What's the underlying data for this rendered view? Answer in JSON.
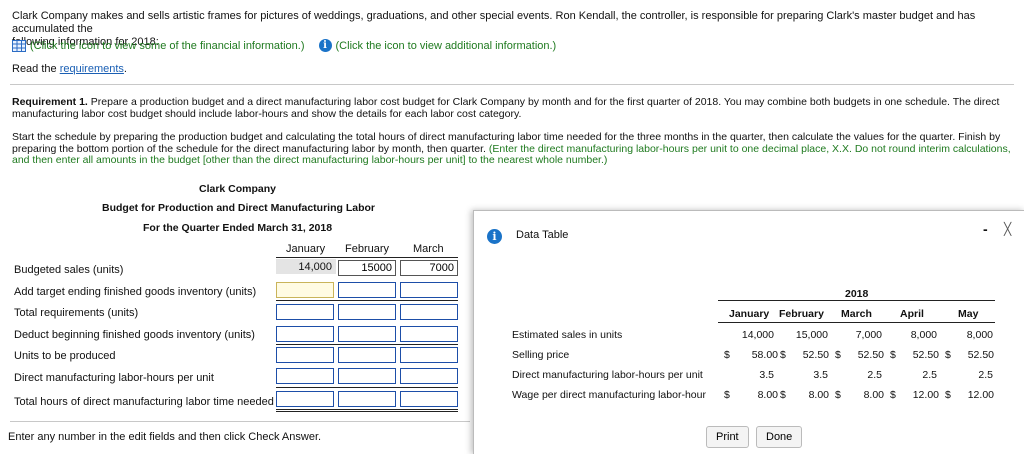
{
  "intro": {
    "line1": "Clark Company makes and sells artistic frames for pictures of weddings, graduations, and other special events. Ron Kendall, the controller, is responsible for preparing Clark's master budget and has accumulated the",
    "line2": "following information for 2018:",
    "fin_info": "(Click the icon to view some of the financial information.)",
    "add_info": "(Click the icon to view additional information.)",
    "read_the": "Read the ",
    "requirements_link": "requirements",
    "period": "."
  },
  "requirement": {
    "label": "Requirement 1.",
    "text_a": " Prepare a production budget and a direct manufacturing labor cost budget for Clark Company by month and for the first quarter of 2018. You may combine both budgets in one schedule. The direct",
    "text_b": "manufacturing labor cost budget should include labor-hours and show the details for each labor cost category.",
    "start_1": "Start the schedule by preparing the production budget and calculating the total hours of direct manufacturing labor time needed for the three months in the quarter, then calculate the values for the quarter. Finish by",
    "start_2a": "preparing the bottom portion of the schedule for the direct manufacturing labor by month, then quarter. ",
    "start_2b": "(Enter the direct manufacturing labor-hours per unit to one decimal place, X.X. Do not round interim calculations,",
    "start_3": "and then enter all amounts in the budget [other than the direct manufacturing labor-hours per unit] to the nearest whole number.)"
  },
  "budget": {
    "company": "Clark Company",
    "title": "Budget for Production and Direct Manufacturing Labor",
    "period": "For the Quarter Ended March 31, 2018",
    "columns": [
      "January",
      "February",
      "March"
    ],
    "rows": [
      {
        "label": "Budgeted sales (units)",
        "values": [
          "14,000",
          "15000",
          "7000"
        ]
      },
      {
        "label": "Add target ending finished goods inventory (units)",
        "values": [
          "",
          "",
          ""
        ]
      },
      {
        "label": "Total requirements (units)",
        "values": [
          "",
          "",
          ""
        ]
      },
      {
        "label": "Deduct beginning finished goods inventory (units)",
        "values": [
          "",
          "",
          ""
        ]
      },
      {
        "label": "Units to be produced",
        "values": [
          "",
          "",
          ""
        ]
      },
      {
        "label": "Direct manufacturing labor-hours per unit",
        "values": [
          "",
          "",
          ""
        ]
      },
      {
        "label": "Total hours of direct manufacturing labor time needed",
        "values": [
          "",
          "",
          ""
        ]
      }
    ]
  },
  "footer": {
    "hint": "Enter any number in the edit fields and then click Check Answer."
  },
  "dialog": {
    "title": "Data Table",
    "minimize": "-",
    "close": "╳",
    "year": "2018",
    "months": [
      "January",
      "February",
      "March",
      "April",
      "May"
    ],
    "rows": [
      {
        "label": "Estimated sales in units",
        "prefix": "",
        "cells": [
          "14,000",
          "15,000",
          "7,000",
          "8,000",
          "8,000"
        ],
        "cell_prefix": ""
      },
      {
        "label": "Selling price",
        "prefix": "$",
        "cells": [
          "58.00",
          "52.50",
          "52.50",
          "52.50",
          "52.50"
        ],
        "cell_prefix": "$"
      },
      {
        "label": "Direct manufacturing labor-hours per unit",
        "prefix": "",
        "cells": [
          "3.5",
          "3.5",
          "2.5",
          "2.5",
          "2.5"
        ],
        "cell_prefix": ""
      },
      {
        "label": "Wage per direct manufacturing labor-hour",
        "prefix": "$",
        "cells": [
          "8.00",
          "8.00",
          "8.00",
          "12.00",
          "12.00"
        ],
        "cell_prefix": "$"
      }
    ],
    "print_label": "Print",
    "done_label": "Done"
  },
  "colors": {
    "link": "#1a5fb4",
    "green": "#1f7a1f",
    "input_border": "#1d4ea8",
    "info": "#1a73c8"
  }
}
